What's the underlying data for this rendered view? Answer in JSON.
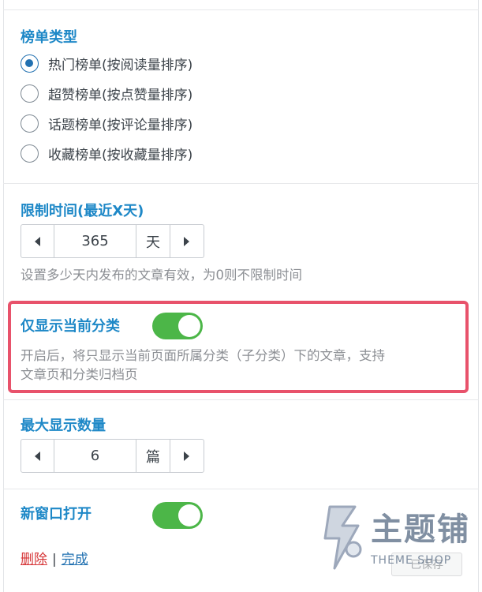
{
  "ranking": {
    "title": "榜单类型",
    "options": [
      {
        "label": "热门榜单(按阅读量排序)",
        "checked": true
      },
      {
        "label": "超赞榜单(按点赞量排序)",
        "checked": false
      },
      {
        "label": "话题榜单(按评论量排序)",
        "checked": false
      },
      {
        "label": "收藏榜单(按收藏量排序)",
        "checked": false
      }
    ]
  },
  "time_limit": {
    "title": "限制时间(最近X天)",
    "value": "365",
    "unit": "天",
    "help": "设置多少天内发布的文章有效，为0则不限制时间"
  },
  "current_category": {
    "title": "仅显示当前分类",
    "enabled": true,
    "help_line1": "开启后，将只显示当前页面所属分类（子分类）下的文章，支持",
    "help_line2": "文章页和分类归档页"
  },
  "max_count": {
    "title": "最大显示数量",
    "value": "6",
    "unit": "篇"
  },
  "new_window": {
    "title": "新窗口打开",
    "enabled": true
  },
  "actions": {
    "delete": "删除",
    "separator": "|",
    "done": "完成",
    "save": "已保存"
  },
  "watermark": {
    "brand": "主题铺",
    "sub": "THEME SHOP"
  },
  "colors": {
    "accent": "#1e88c7",
    "toggle_on": "#4cb648",
    "highlight": "#e8526b",
    "delete": "#d63638"
  }
}
